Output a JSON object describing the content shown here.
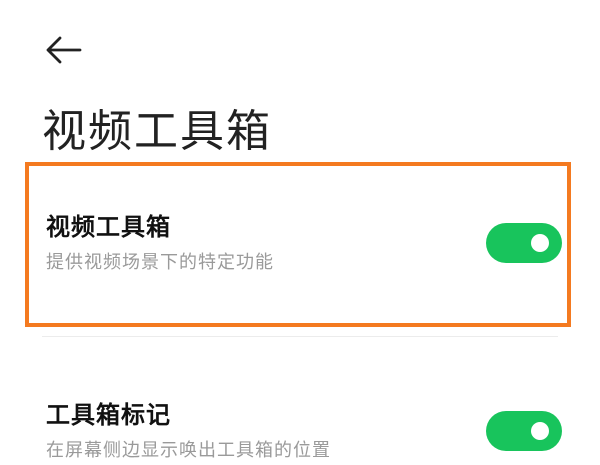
{
  "header": {
    "back_icon": "arrow-left-icon",
    "title": "视频工具箱"
  },
  "settings": [
    {
      "title": "视频工具箱",
      "description": "提供视频场景下的特定功能",
      "enabled": true
    },
    {
      "title": "工具箱标记",
      "description": "在屏幕侧边显示唤出工具箱的位置",
      "enabled": true
    }
  ],
  "colors": {
    "toggle_on": "#18C45C",
    "highlight": "#F47A20"
  }
}
